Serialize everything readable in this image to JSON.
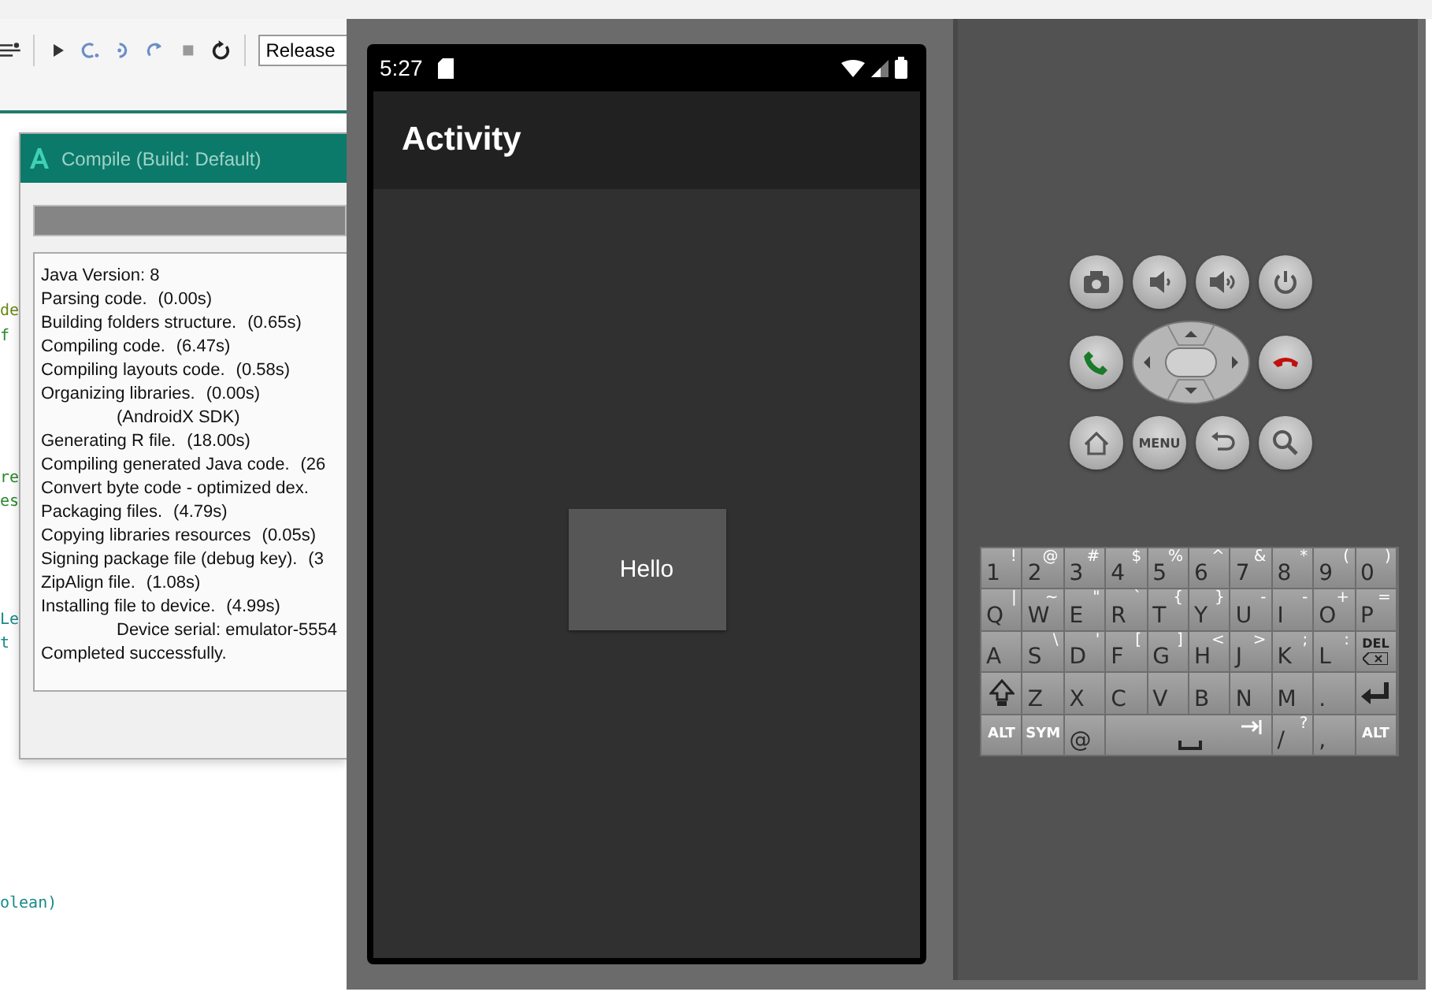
{
  "ide": {
    "toolbar": {
      "build_config": "Release"
    },
    "code_lines": [
      {
        "text": "de",
        "color": "#6a8a10"
      },
      {
        "text": "f",
        "color": "#2a8a2a"
      },
      {
        "text": "re",
        "color": "#2a8a2a"
      },
      {
        "text": "es",
        "color": "#2a8a2a"
      },
      {
        "text": "Le",
        "color": "#1a8a8a"
      },
      {
        "text": "t",
        "color": "#1a8a8a"
      },
      {
        "text": "olean)",
        "color": "#1a8a8a"
      }
    ]
  },
  "compile_dialog": {
    "title": "Compile (Build: Default)",
    "progress": {
      "level": 1
    },
    "log": [
      {
        "text": "Java Version: 8"
      },
      {
        "text": "Parsing code.",
        "time": "(0.00s)"
      },
      {
        "text": "Building folders structure.",
        "time": "(0.65s)"
      },
      {
        "text": "Compiling code.",
        "time": "(6.47s)"
      },
      {
        "text": "Compiling layouts code.",
        "time": "(0.58s)"
      },
      {
        "text": "Organizing libraries.",
        "time": "(0.00s)"
      },
      {
        "text": "(AndroidX SDK)",
        "indented": true
      },
      {
        "text": "Generating R file.",
        "time": "(18.00s)"
      },
      {
        "text": "Compiling generated Java code.",
        "time": "(26"
      },
      {
        "text": "Convert byte code - optimized dex."
      },
      {
        "text": "Packaging files.",
        "time": "(4.79s)"
      },
      {
        "text": "Copying libraries resources",
        "time": "(0.05s)"
      },
      {
        "text": "Signing package file (debug key).",
        "time": "(3"
      },
      {
        "text": "ZipAlign file.",
        "time": "(1.08s)"
      },
      {
        "text": "Installing file to device.",
        "time": "(4.99s)"
      },
      {
        "text": "Device serial: emulator-5554",
        "indented": true
      },
      {
        "text": "Completed successfully."
      }
    ]
  },
  "emulator": {
    "status_bar": {
      "time": "5:27"
    },
    "app_bar": {
      "title": "Activity"
    },
    "button": {
      "label": "Hello"
    },
    "hardware": {
      "menu_label": "MENU"
    },
    "keyboard": [
      [
        {
          "kind": "char",
          "label": "1",
          "alt": "!"
        },
        {
          "kind": "char",
          "label": "2",
          "alt": "@"
        },
        {
          "kind": "char",
          "label": "3",
          "alt": "#"
        },
        {
          "kind": "char",
          "label": "4",
          "alt": "$"
        },
        {
          "kind": "char",
          "label": "5",
          "alt": "%"
        },
        {
          "kind": "char",
          "label": "6",
          "alt": "^"
        },
        {
          "kind": "char",
          "label": "7",
          "alt": "&"
        },
        {
          "kind": "char",
          "label": "8",
          "alt": "*"
        },
        {
          "kind": "char",
          "label": "9",
          "alt": "("
        },
        {
          "kind": "char",
          "label": "0",
          "alt": ")"
        }
      ],
      [
        {
          "kind": "char",
          "label": "Q",
          "alt": "|"
        },
        {
          "kind": "char",
          "label": "W",
          "alt": "~"
        },
        {
          "kind": "char",
          "label": "E",
          "alt": "\""
        },
        {
          "kind": "char",
          "label": "R",
          "alt": "`"
        },
        {
          "kind": "char",
          "label": "T",
          "alt": "{"
        },
        {
          "kind": "char",
          "label": "Y",
          "alt": "}"
        },
        {
          "kind": "char",
          "label": "U",
          "alt": "-"
        },
        {
          "kind": "char",
          "label": "I",
          "alt": "-"
        },
        {
          "kind": "char",
          "label": "O",
          "alt": "+"
        },
        {
          "kind": "char",
          "label": "P",
          "alt": "="
        }
      ],
      [
        {
          "kind": "char",
          "label": "A"
        },
        {
          "kind": "char",
          "label": "S",
          "alt": "\\"
        },
        {
          "kind": "char",
          "label": "D",
          "alt": "'"
        },
        {
          "kind": "char",
          "label": "F",
          "alt": "["
        },
        {
          "kind": "char",
          "label": "G",
          "alt": "]"
        },
        {
          "kind": "char",
          "label": "H",
          "alt": "<"
        },
        {
          "kind": "char",
          "label": "J",
          "alt": ">"
        },
        {
          "kind": "char",
          "label": "K",
          "alt": ";"
        },
        {
          "kind": "char",
          "label": "L",
          "alt": ":"
        },
        {
          "kind": "delete",
          "label": "DEL"
        }
      ],
      [
        {
          "kind": "shift"
        },
        {
          "kind": "char",
          "label": "Z"
        },
        {
          "kind": "char",
          "label": "X"
        },
        {
          "kind": "char",
          "label": "C"
        },
        {
          "kind": "char",
          "label": "V"
        },
        {
          "kind": "char",
          "label": "B"
        },
        {
          "kind": "char",
          "label": "N"
        },
        {
          "kind": "char",
          "label": "M"
        },
        {
          "kind": "char",
          "label": "."
        },
        {
          "kind": "enter"
        }
      ],
      [
        {
          "kind": "modifier",
          "label": "ALT"
        },
        {
          "kind": "modifier",
          "label": "SYM"
        },
        {
          "kind": "char",
          "label": "@"
        },
        {
          "kind": "space"
        },
        {
          "kind": "char",
          "label": "/",
          "alt": "?"
        },
        {
          "kind": "char",
          "label": ","
        },
        {
          "kind": "modifier",
          "label": "ALT"
        }
      ]
    ]
  }
}
